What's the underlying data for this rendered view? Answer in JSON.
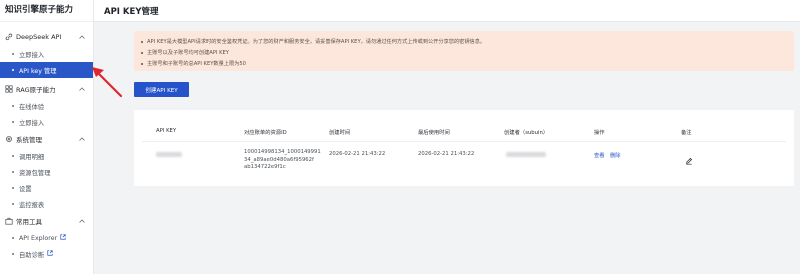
{
  "sidebar": {
    "brand": "知识引擎原子能力",
    "groups": [
      {
        "label": "DeepSeek API",
        "items": [
          {
            "label": "立即接入"
          },
          {
            "label": "API key 管理"
          }
        ]
      },
      {
        "label": "RAG原子能力",
        "items": [
          {
            "label": "在线体验"
          },
          {
            "label": "立即接入"
          }
        ]
      },
      {
        "label": "系统管理",
        "items": [
          {
            "label": "调用明细"
          },
          {
            "label": "资源包管理"
          },
          {
            "label": "设置"
          },
          {
            "label": "监控报表"
          }
        ]
      },
      {
        "label": "常用工具",
        "items": [
          {
            "label": "API Explorer"
          },
          {
            "label": "自助诊断"
          }
        ]
      }
    ],
    "active_item": "API key 管理"
  },
  "header": {
    "title": "API KEY管理"
  },
  "notice": {
    "lines": [
      "API KEY是大模型API请求时的安全鉴权凭证。为了您的财产和服务安全，请妥善保存API KEY，请勿通过任何方式上传或到公开分享您的密钥信息。",
      "主账号以及子账号均可创建API KEY",
      "主账号和子账号的总API KEY数量上限为50"
    ],
    "background": "#fde7dd"
  },
  "create_button": {
    "label": "创建API KEY"
  },
  "table": {
    "columns": [
      "API KEY",
      "对应账单的资源ID",
      "创建时间",
      "最后使用时间",
      "创建者（subuin）",
      "操作",
      "备注"
    ],
    "rows": [
      {
        "resource_id_lines": [
          "100014998134_1000149991",
          "34_a89ae0d480a6f95962f",
          "ab134722e9f1c"
        ],
        "created_at": "2026-02-21 21:43:22",
        "last_used_at": "2026-02-21 21:43:22",
        "actions": [
          "查看",
          "删除"
        ]
      }
    ]
  },
  "colors": {
    "accent": "#2653c9",
    "sidebar_active": "#2a57c8",
    "annotation_arrow": "#e0272f"
  }
}
